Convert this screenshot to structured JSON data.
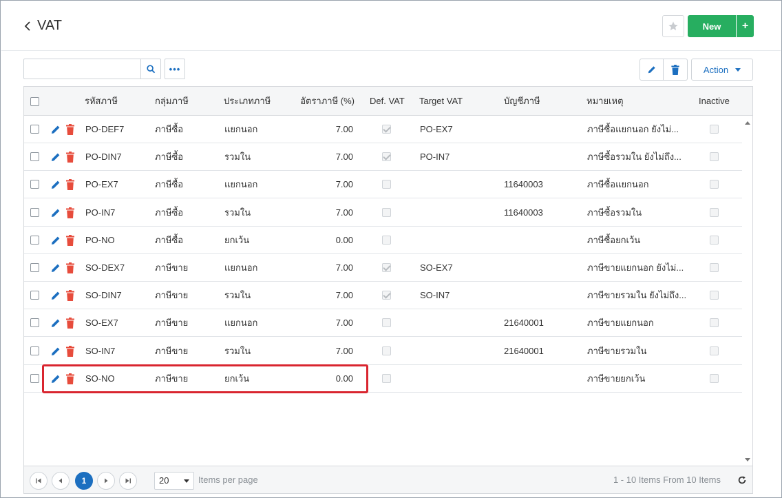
{
  "header": {
    "title": "VAT",
    "new_label": "New",
    "new_plus": "+"
  },
  "toolbar": {
    "search_placeholder": "",
    "more_label": "•••",
    "action_label": "Action"
  },
  "table": {
    "columns": [
      "รหัสภาษี",
      "กลุ่มภาษี",
      "ประเภทภาษี",
      "อัตราภาษี (%)",
      "Def. VAT",
      "Target VAT",
      "บัญชีภาษี",
      "หมายเหตุ",
      "Inactive"
    ],
    "rows": [
      {
        "code": "PO-DEF7",
        "group": "ภาษีซื้อ",
        "type": "แยกนอก",
        "rate": "7.00",
        "def_vat": true,
        "target": "PO-EX7",
        "account": "",
        "note": "ภาษีซื้อแยกนอก ยังไม่...",
        "inactive": false
      },
      {
        "code": "PO-DIN7",
        "group": "ภาษีซื้อ",
        "type": "รวมใน",
        "rate": "7.00",
        "def_vat": true,
        "target": "PO-IN7",
        "account": "",
        "note": "ภาษีซื้อรวมใน ยังไม่ถึง...",
        "inactive": false
      },
      {
        "code": "PO-EX7",
        "group": "ภาษีซื้อ",
        "type": "แยกนอก",
        "rate": "7.00",
        "def_vat": false,
        "target": "",
        "account": "11640003",
        "note": "ภาษีซื้อแยกนอก",
        "inactive": false
      },
      {
        "code": "PO-IN7",
        "group": "ภาษีซื้อ",
        "type": "รวมใน",
        "rate": "7.00",
        "def_vat": false,
        "target": "",
        "account": "11640003",
        "note": "ภาษีซื้อรวมใน",
        "inactive": false
      },
      {
        "code": "PO-NO",
        "group": "ภาษีซื้อ",
        "type": "ยกเว้น",
        "rate": "0.00",
        "def_vat": false,
        "target": "",
        "account": "",
        "note": "ภาษีซื้อยกเว้น",
        "inactive": false
      },
      {
        "code": "SO-DEX7",
        "group": "ภาษีขาย",
        "type": "แยกนอก",
        "rate": "7.00",
        "def_vat": true,
        "target": "SO-EX7",
        "account": "",
        "note": "ภาษีขายแยกนอก ยังไม่...",
        "inactive": false
      },
      {
        "code": "SO-DIN7",
        "group": "ภาษีขาย",
        "type": "รวมใน",
        "rate": "7.00",
        "def_vat": true,
        "target": "SO-IN7",
        "account": "",
        "note": "ภาษีขายรวมใน ยังไม่ถึง...",
        "inactive": false
      },
      {
        "code": "SO-EX7",
        "group": "ภาษีขาย",
        "type": "แยกนอก",
        "rate": "7.00",
        "def_vat": false,
        "target": "",
        "account": "21640001",
        "note": "ภาษีขายแยกนอก",
        "inactive": false
      },
      {
        "code": "SO-IN7",
        "group": "ภาษีขาย",
        "type": "รวมใน",
        "rate": "7.00",
        "def_vat": false,
        "target": "",
        "account": "21640001",
        "note": "ภาษีขายรวมใน",
        "inactive": false
      },
      {
        "code": "SO-NO",
        "group": "ภาษีขาย",
        "type": "ยกเว้น",
        "rate": "0.00",
        "def_vat": false,
        "target": "",
        "account": "",
        "note": "ภาษีขายยกเว้น",
        "inactive": false
      }
    ]
  },
  "pager": {
    "current_page": "1",
    "page_size": "20",
    "items_per_page_label": "Items per page",
    "items_info": "1 - 10 Items From 10 Items"
  },
  "colors": {
    "accent": "#1c6fc0",
    "new_button": "#27ae60",
    "delete_icon": "#e74c3c",
    "highlight": "#d9252f"
  },
  "icons": [
    "chevron-left-icon",
    "star-icon",
    "plus-icon",
    "search-icon",
    "more-icon",
    "pencil-icon",
    "trash-icon",
    "caret-down-icon",
    "refresh-icon"
  ]
}
